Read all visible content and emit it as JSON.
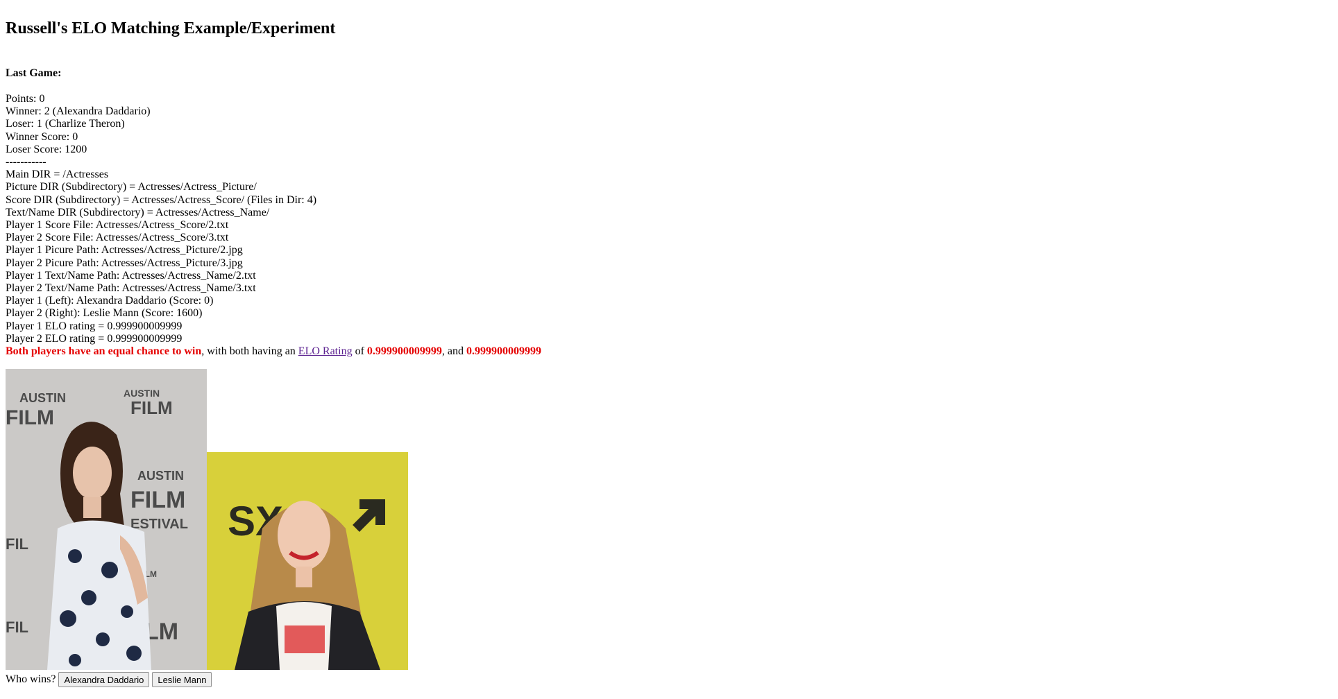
{
  "page": {
    "title": "Russell's ELO Matching Example/Experiment"
  },
  "last_game": {
    "heading": "Last Game:",
    "points": "Points: 0",
    "winner": "Winner: 2 (Alexandra Daddario)",
    "loser": "Loser: 1 (Charlize Theron)",
    "winner_score": "Winner Score: 0",
    "loser_score": "Loser Score: 1200",
    "separator": "-----------"
  },
  "dirs": {
    "main": "Main DIR = /Actresses",
    "picture": "Picture DIR (Subdirectory) = Actresses/Actress_Picture/",
    "score": "Score DIR (Subdirectory) = Actresses/Actress_Score/ (Files in Dir: 4)",
    "text_name": "Text/Name DIR (Subdirectory) = Actresses/Actress_Name/"
  },
  "players": {
    "p1_score_file": "Player 1 Score File: Actresses/Actress_Score/2.txt",
    "p2_score_file": "Player 2 Score File: Actresses/Actress_Score/3.txt",
    "p1_picture_path": "Player 1 Picure Path: Actresses/Actress_Picture/2.jpg",
    "p2_picture_path": "Player 2 Picure Path: Actresses/Actress_Picture/3.jpg",
    "p1_name_path": "Player 1 Text/Name Path: Actresses/Actress_Name/2.txt",
    "p2_name_path": "Player 2 Text/Name Path: Actresses/Actress_Name/3.txt",
    "p1_summary": "Player 1 (Left): Alexandra Daddario (Score: 0)",
    "p2_summary": "Player 2 (Right): Leslie Mann (Score: 1600)",
    "p1_elo": "Player 1 ELO rating = 0.999900009999",
    "p2_elo": "Player 2 ELO rating = 0.999900009999"
  },
  "chance": {
    "highlight": "Both players have an equal chance to win",
    "middle": ", with both having an ",
    "link_text": "ELO Rating",
    "of": " of ",
    "rating1": "0.999900009999",
    "and": ", and ",
    "rating2": "0.999900009999"
  },
  "photos": {
    "left_backdrop_text": "AUSTIN FILM FESTIVAL",
    "right_backdrop_text": "SX"
  },
  "vote": {
    "prompt": "Who wins?",
    "left_button": "Alexandra Daddario",
    "right_button": "Leslie Mann"
  },
  "colors": {
    "highlight": "#e50000",
    "link_visited": "#5a1f8f",
    "left_backdrop": "#c8c6c4",
    "right_backdrop": "#d7cf38"
  }
}
